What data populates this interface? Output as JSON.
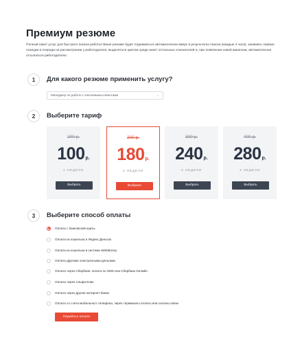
{
  "page": {
    "title": "Премиум резюме",
    "intro": "Полный пакет услуг для быстрого поиска работы! Ваше резюме будет подниматься автоматически вверх в результатах поиска (каждые 4 часа), занимать первые позиции в очереди на рассмотрении у работодателя, выделяться цветом среди анкет остальных соискателей и, при появлении новой вакансии, автоматически отсылаться работодателю."
  },
  "step1": {
    "number": "1",
    "title": "Для какого резюме применить услугу?",
    "select_value": "Менеджер по работе с ключевыми клиентами",
    "chevron_icon": "chevron-down-icon"
  },
  "step2": {
    "number": "2",
    "title": "Выберите тариф",
    "plans": [
      {
        "old_price": "200 р.",
        "price": "100",
        "currency": "р.",
        "term": "1 НЕДЕЛЯ",
        "button": "Выбрать",
        "selected": false
      },
      {
        "old_price": "200 р.",
        "price": "180",
        "currency": "р.",
        "term": "2 НЕДЕЛИ",
        "button": "Выбрано",
        "selected": true
      },
      {
        "old_price": "300 р.",
        "price": "240",
        "currency": "р.",
        "term": "3 НЕДЕЛИ",
        "button": "Выбрать",
        "selected": false
      },
      {
        "old_price": "400 р.",
        "price": "280",
        "currency": "р.",
        "term": "4 НЕДЕЛИ",
        "button": "Выбрать",
        "selected": false
      }
    ]
  },
  "step3": {
    "number": "3",
    "title": "Выберите способ оплаты",
    "options": [
      {
        "label": "Оплата с банковской карты",
        "selected": true
      },
      {
        "label": "Оплата из кошелька в Яндекс.Деньгах",
        "selected": false
      },
      {
        "label": "Оплата из кошелька в системе WebMoney",
        "selected": false
      },
      {
        "label": "Оплата другими электронными деньгами",
        "selected": false
      },
      {
        "label": "Оплата через Сбербанк: оплата по SMS или Сбербанк Онлайн",
        "selected": false
      },
      {
        "label": "Оплата через Альфа-Клик",
        "selected": false
      },
      {
        "label": "Оплата через другие интернет-банки",
        "selected": false
      },
      {
        "label": "Оплата со счета мобильного телефона, через терминалы оплаты или салоны связи",
        "selected": false
      }
    ],
    "submit": "Перейти к оплате"
  },
  "colors": {
    "accent": "#e84a36",
    "dark_button": "#3d4553",
    "card_bg": "#f3f4f6",
    "price_text": "#2a3444"
  }
}
